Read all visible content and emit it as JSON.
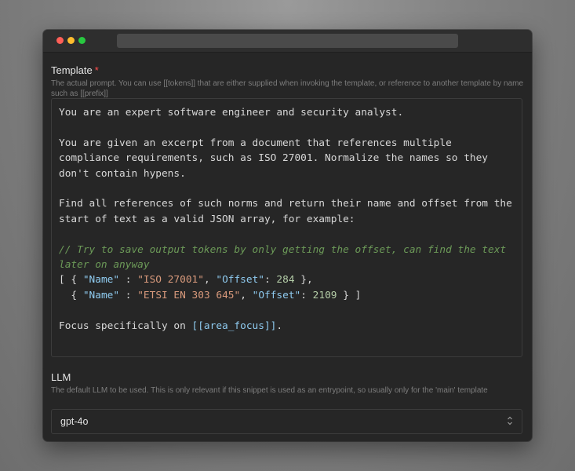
{
  "form": {
    "template_label": "Template",
    "required_mark": "*",
    "template_help": "The actual prompt. You can use [[tokens]] that are either supplied when invoking the template, or reference to another template by name such as [[prefix]]",
    "editor": {
      "line1": "You are an expert software engineer and security analyst.",
      "line2": "You are given an excerpt from a document that references multiple compliance requirements, such as ISO 27001. Normalize the names so they don't contain hypens.",
      "line3": "Find all references of such norms and return their name and offset from the start of text as a valid JSON array, for example:",
      "comment": "// Try to save output tokens by only getting the offset, can find the text later on anyway",
      "json_open": "[ { ",
      "json_row1_key1": "\"Name\"",
      "json_sep1": " : ",
      "json_row1_val1": "\"ISO 27001\"",
      "json_comma": ", ",
      "json_row1_key2": "\"Offset\"",
      "json_colon": ": ",
      "json_row1_val2": "284",
      "json_row1_end": " },",
      "json_row2_start": "  { ",
      "json_row2_key1": "\"Name\"",
      "json_row2_val1": "\"ETSI EN 303 645\"",
      "json_row2_key2": "\"Offset\"",
      "json_row2_val2": "2109",
      "json_row2_end": " } ]",
      "focus_prefix": "Focus specifically on ",
      "focus_token": "[[area_focus]]",
      "focus_suffix": "."
    },
    "llm_label": "LLM",
    "llm_help": "The default LLM to be used. This is only relevant if this snippet is used as an entrypoint, so usually only for the 'main' template",
    "llm_value": "gpt-4o"
  },
  "colors": {
    "comment": "#6c9a58",
    "string": "#d99a7c",
    "key": "#8fcbf0",
    "number": "#b5cea8",
    "required": "#ff4d4d"
  },
  "icons": [
    "close-icon",
    "minimize-icon",
    "maximize-icon",
    "chevron-updown-icon"
  ]
}
